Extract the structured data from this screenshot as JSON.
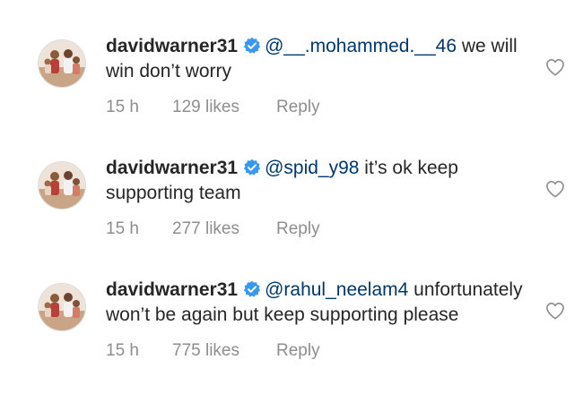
{
  "comments": [
    {
      "username": "davidwarner31",
      "mention": "@__.mohammed.__46",
      "text": " we will win don’t worry",
      "time": "15 h",
      "likes": "129 likes",
      "reply": "Reply"
    },
    {
      "username": "davidwarner31",
      "mention": "@spid_y98",
      "text": " it’s ok keep supporting team",
      "time": "15 h",
      "likes": "277 likes",
      "reply": "Reply"
    },
    {
      "username": "davidwarner31",
      "mention": "@rahul_neelam4",
      "text": " unfortunately won’t be again but keep supporting please",
      "time": "15 h",
      "likes": "775 likes",
      "reply": "Reply"
    }
  ],
  "icons": {
    "verified": "verified-badge-icon",
    "like": "heart-outline-icon",
    "avatar": "profile-photo"
  },
  "colors": {
    "verified_blue": "#3897f0",
    "mention_blue": "#00376b",
    "meta_gray": "#8e8e8e",
    "text": "#262626"
  }
}
